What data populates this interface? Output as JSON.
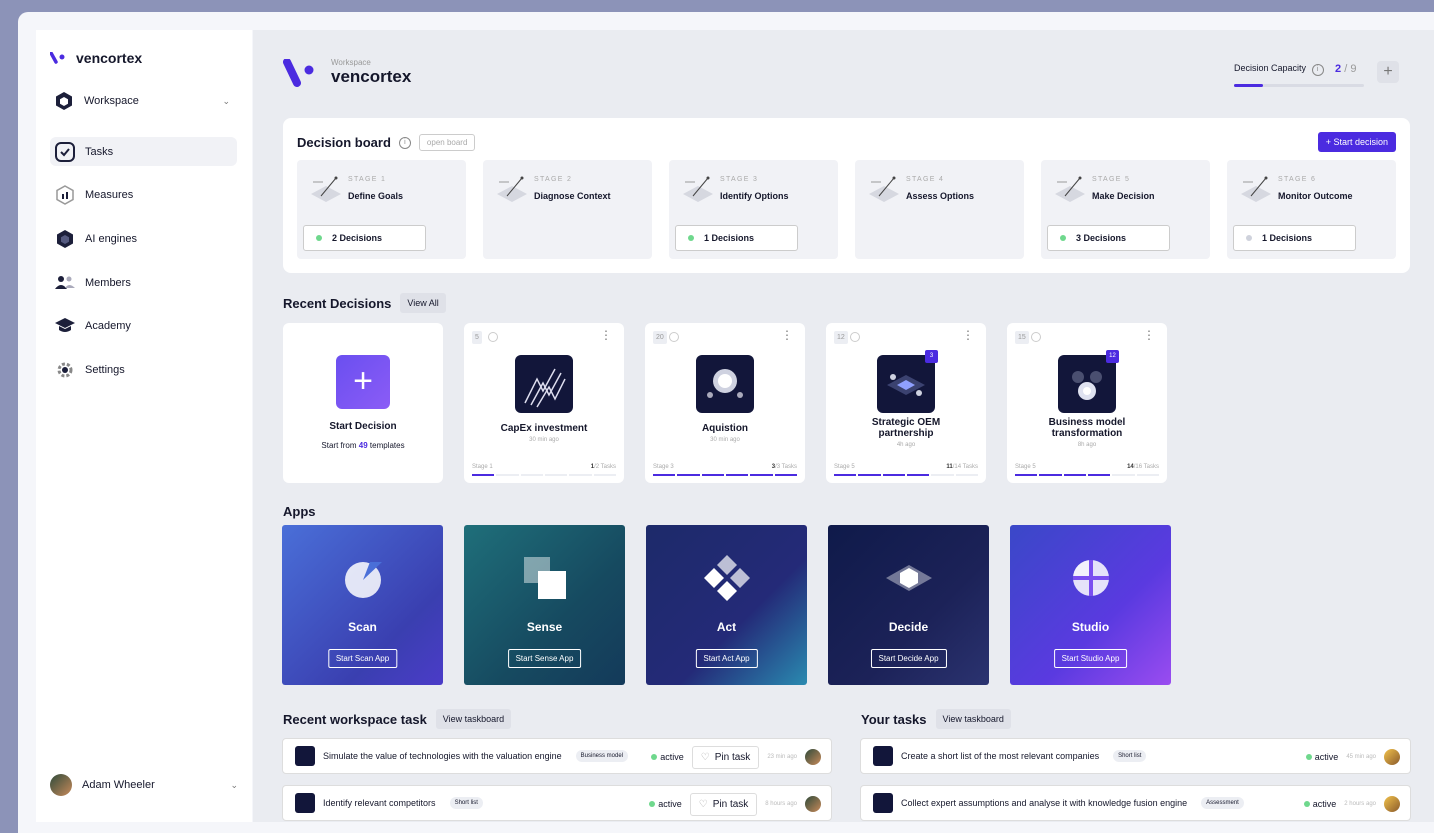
{
  "brand": {
    "name": "vencortex",
    "accent": "#4b2be0"
  },
  "sidebar": {
    "workspace_label": "Workspace",
    "items": [
      {
        "label": "Tasks",
        "icon": "check-icon",
        "active": true
      },
      {
        "label": "Measures",
        "icon": "measures-icon"
      },
      {
        "label": "AI engines",
        "icon": "hexagon-icon"
      },
      {
        "label": "Members",
        "icon": "users-icon"
      },
      {
        "label": "Academy",
        "icon": "graduation-cap-icon"
      },
      {
        "label": "Settings",
        "icon": "gear-icon"
      }
    ],
    "user": "Adam Wheeler"
  },
  "header": {
    "workspace_label": "Workspace",
    "workspace_name": "vencortex",
    "capacity_label": "Decision Capacity",
    "capacity_used": "2",
    "capacity_sep": "/",
    "capacity_total": "9",
    "capacity_fraction": 0.22
  },
  "board": {
    "title": "Decision board",
    "open_label": "open board",
    "start_label": "Start decision",
    "stages": [
      {
        "num": "STAGE 1",
        "name": "Define Goals",
        "decisions": "2",
        "dec_label": "Decisions",
        "dot": "green"
      },
      {
        "num": "STAGE 2",
        "name": "Diagnose Context",
        "decisions": null
      },
      {
        "num": "STAGE 3",
        "name": "Identify Options",
        "decisions": "1",
        "dec_label": "Decisions",
        "dot": "green"
      },
      {
        "num": "STAGE 4",
        "name": "Assess Options",
        "decisions": null
      },
      {
        "num": "STAGE 5",
        "name": "Make Decision",
        "decisions": "3",
        "dec_label": "Decisions",
        "dot": "green"
      },
      {
        "num": "STAGE 6",
        "name": "Monitor Outcome",
        "decisions": "1",
        "dec_label": "Decisions",
        "dot": "grey"
      }
    ]
  },
  "recent": {
    "title": "Recent Decisions",
    "view_all": "View All",
    "new_card": {
      "title": "Start Decision",
      "sub_pre": "Start from ",
      "count": "49",
      "sub_post": " templates"
    },
    "cards": [
      {
        "count": "5",
        "name": "CapEx investment",
        "time": "30 min ago",
        "stage": "Stage 1",
        "done": "1",
        "total": "/2 Tasks",
        "progress": 0.14,
        "badge": null
      },
      {
        "count": "20",
        "name": "Aquistion",
        "time": "30 min ago",
        "stage": "Stage 3",
        "done": "3",
        "total": "/3 Tasks",
        "progress": 1.0,
        "badge": null
      },
      {
        "count": "12",
        "name": "Strategic OEM partnership",
        "time": "4h ago",
        "stage": "Stage 5",
        "done": "11",
        "total": "/14 Tasks",
        "progress": 0.6,
        "badge": "3"
      },
      {
        "count": "15",
        "name": "Business model transformation",
        "time": "8h ago",
        "stage": "Stage 5",
        "done": "14",
        "total": "/16 Tasks",
        "progress": 0.6,
        "badge": "12"
      }
    ]
  },
  "apps": {
    "title": "Apps",
    "items": [
      {
        "name": "Scan",
        "btn": "Start Scan App",
        "icon": "scan-icon"
      },
      {
        "name": "Sense",
        "btn": "Start Sense App",
        "icon": "sense-icon"
      },
      {
        "name": "Act",
        "btn": "Start Act App",
        "icon": "act-icon"
      },
      {
        "name": "Decide",
        "btn": "Start Decide App",
        "icon": "decide-icon"
      },
      {
        "name": "Studio",
        "btn": "Start Studio App",
        "icon": "studio-icon"
      }
    ]
  },
  "workspace_tasks": {
    "title": "Recent workspace task",
    "view": "View taskboard",
    "items": [
      {
        "text": "Simulate the value of technologies with the valuation engine",
        "label": "Business model",
        "status": "active",
        "pin": "Pin task",
        "time": "23 min ago"
      },
      {
        "text": "Identify relevant competitors",
        "label": "Short list",
        "status": "active",
        "pin": "Pin task",
        "time": "8 hours ago"
      }
    ]
  },
  "your_tasks": {
    "title": "Your tasks",
    "view": "View taskboard",
    "items": [
      {
        "text": "Create a short list of the most relevant companies",
        "label": "Short list",
        "status": "active",
        "time": "45 min ago"
      },
      {
        "text": "Collect expert assumptions  and analyse it with knowledge fusion engine",
        "label": "Assessment",
        "status": "active",
        "time": "2 hours ago"
      }
    ]
  }
}
